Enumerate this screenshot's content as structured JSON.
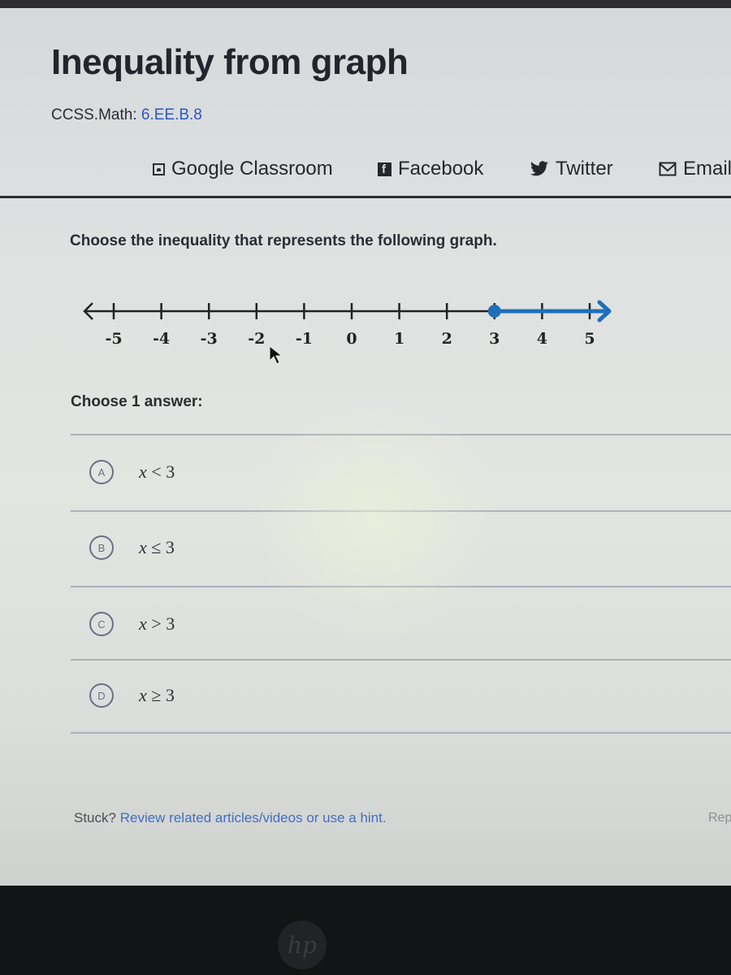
{
  "page": {
    "title": "Inequality from graph",
    "standard_label": "CCSS.Math:",
    "standard_code": "6.EE.B.8"
  },
  "share": {
    "items": [
      {
        "label": "Google Classroom",
        "icon": "google-classroom-icon"
      },
      {
        "label": "Facebook",
        "icon": "facebook-icon"
      },
      {
        "label": "Twitter",
        "icon": "twitter-icon"
      },
      {
        "label": "Email",
        "icon": "email-icon"
      }
    ]
  },
  "question": {
    "prompt": "Choose the inequality that represents the following graph.",
    "number_line": {
      "min": -5,
      "max": 5,
      "tick_labels": [
        "-5",
        "-4",
        "-3",
        "-2",
        "-1",
        "0",
        "1",
        "2",
        "3",
        "4",
        "5"
      ],
      "point": 3,
      "point_type": "closed",
      "ray_direction": "right",
      "highlight_color": "#1f6fba"
    }
  },
  "answers": {
    "prompt": "Choose 1 answer:",
    "choices": [
      {
        "letter": "A",
        "var": "x",
        "op": "<",
        "value": "3"
      },
      {
        "letter": "B",
        "var": "x",
        "op": "≤",
        "value": "3"
      },
      {
        "letter": "C",
        "var": "x",
        "op": ">",
        "value": "3"
      },
      {
        "letter": "D",
        "var": "x",
        "op": "≥",
        "value": "3"
      }
    ]
  },
  "footer": {
    "stuck_label": "Stuck?",
    "hint_link": "Review related articles/videos or use a hint.",
    "report_label": "Rep"
  },
  "device": {
    "logo": "hp"
  }
}
